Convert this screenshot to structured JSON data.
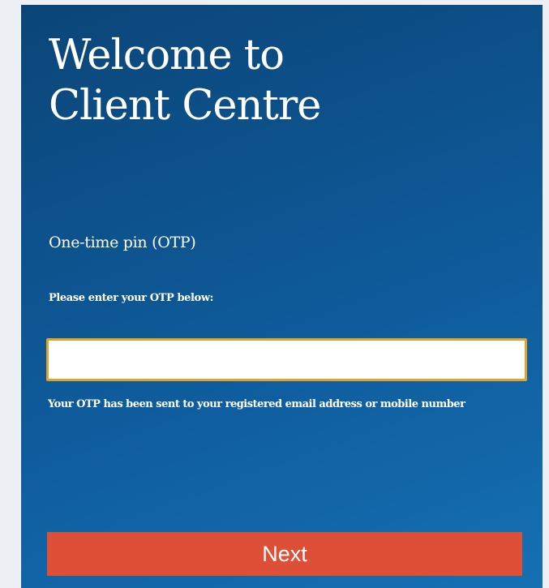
{
  "header": {
    "title_line1": "Welcome to",
    "title_line2": "Client Centre"
  },
  "otp": {
    "heading": "One-time pin (OTP)",
    "prompt": "Please enter your OTP below:",
    "value": "",
    "hint": "Your OTP has been sent to your registered email address or mobile number"
  },
  "actions": {
    "next_label": "Next"
  },
  "colors": {
    "panel": "#0f5d9e",
    "input_border": "#e6a12a",
    "button": "#de4f38"
  }
}
